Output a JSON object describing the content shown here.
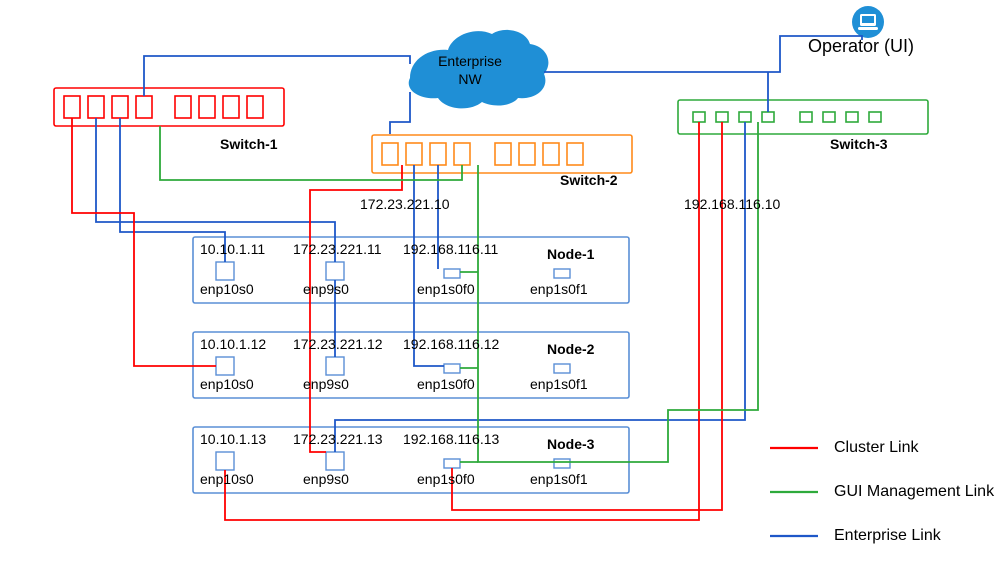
{
  "operator": {
    "label": "Operator (UI)"
  },
  "cloud": {
    "line1": "Enterprise",
    "line2": "NW"
  },
  "switches": {
    "s1": {
      "label": "Switch-1"
    },
    "s2": {
      "label": "Switch-2"
    },
    "s3": {
      "label": "Switch-3"
    }
  },
  "ips": {
    "mid1": "172.23.221.10",
    "mid2": "192.168.116.10"
  },
  "nodes": [
    {
      "name": "Node-1",
      "ifs": [
        {
          "ip": "10.10.1.11",
          "dev": "enp10s0"
        },
        {
          "ip": "172.23.221.11",
          "dev": "enp9s0"
        },
        {
          "ip": "192.168.116.11",
          "dev": "enp1s0f0"
        },
        {
          "ip": "",
          "dev": "enp1s0f1"
        }
      ]
    },
    {
      "name": "Node-2",
      "ifs": [
        {
          "ip": "10.10.1.12",
          "dev": "enp10s0"
        },
        {
          "ip": "172.23.221.12",
          "dev": "enp9s0"
        },
        {
          "ip": "192.168.116.12",
          "dev": "enp1s0f0"
        },
        {
          "ip": "",
          "dev": "enp1s0f1"
        }
      ]
    },
    {
      "name": "Node-3",
      "ifs": [
        {
          "ip": "10.10.1.13",
          "dev": "enp10s0"
        },
        {
          "ip": "172.23.221.13",
          "dev": "enp9s0"
        },
        {
          "ip": "192.168.116.13",
          "dev": "enp1s0f0"
        },
        {
          "ip": "",
          "dev": "enp1s0f1"
        }
      ]
    }
  ],
  "legend": {
    "cluster": "Cluster Link",
    "gui": "GUI Management Link",
    "enterprise": "Enterprise Link"
  },
  "colors": {
    "red": "#ff0000",
    "green": "#2eaa3b",
    "blue": "#1e57c8",
    "orange": "#ff8a1a",
    "nodeBlue": "#5a8fd6",
    "cloud": "#1f8fd6"
  }
}
